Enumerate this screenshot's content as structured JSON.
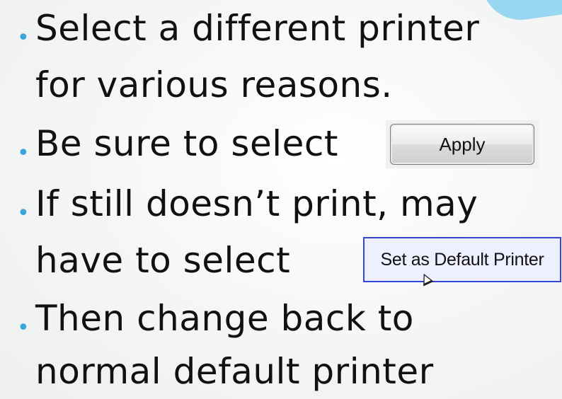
{
  "slide": {
    "bullets": [
      {
        "line1": "Select a different printer",
        "line2": "for various reasons."
      },
      {
        "line1": "Be sure to select"
      },
      {
        "line1": "If still doesn’t print, may",
        "line2": "have to select"
      },
      {
        "line1": "Then change back to",
        "line2": "normal default printer"
      }
    ],
    "apply_button_label": "Apply",
    "default_printer_button_label": "Set as Default Printer"
  }
}
